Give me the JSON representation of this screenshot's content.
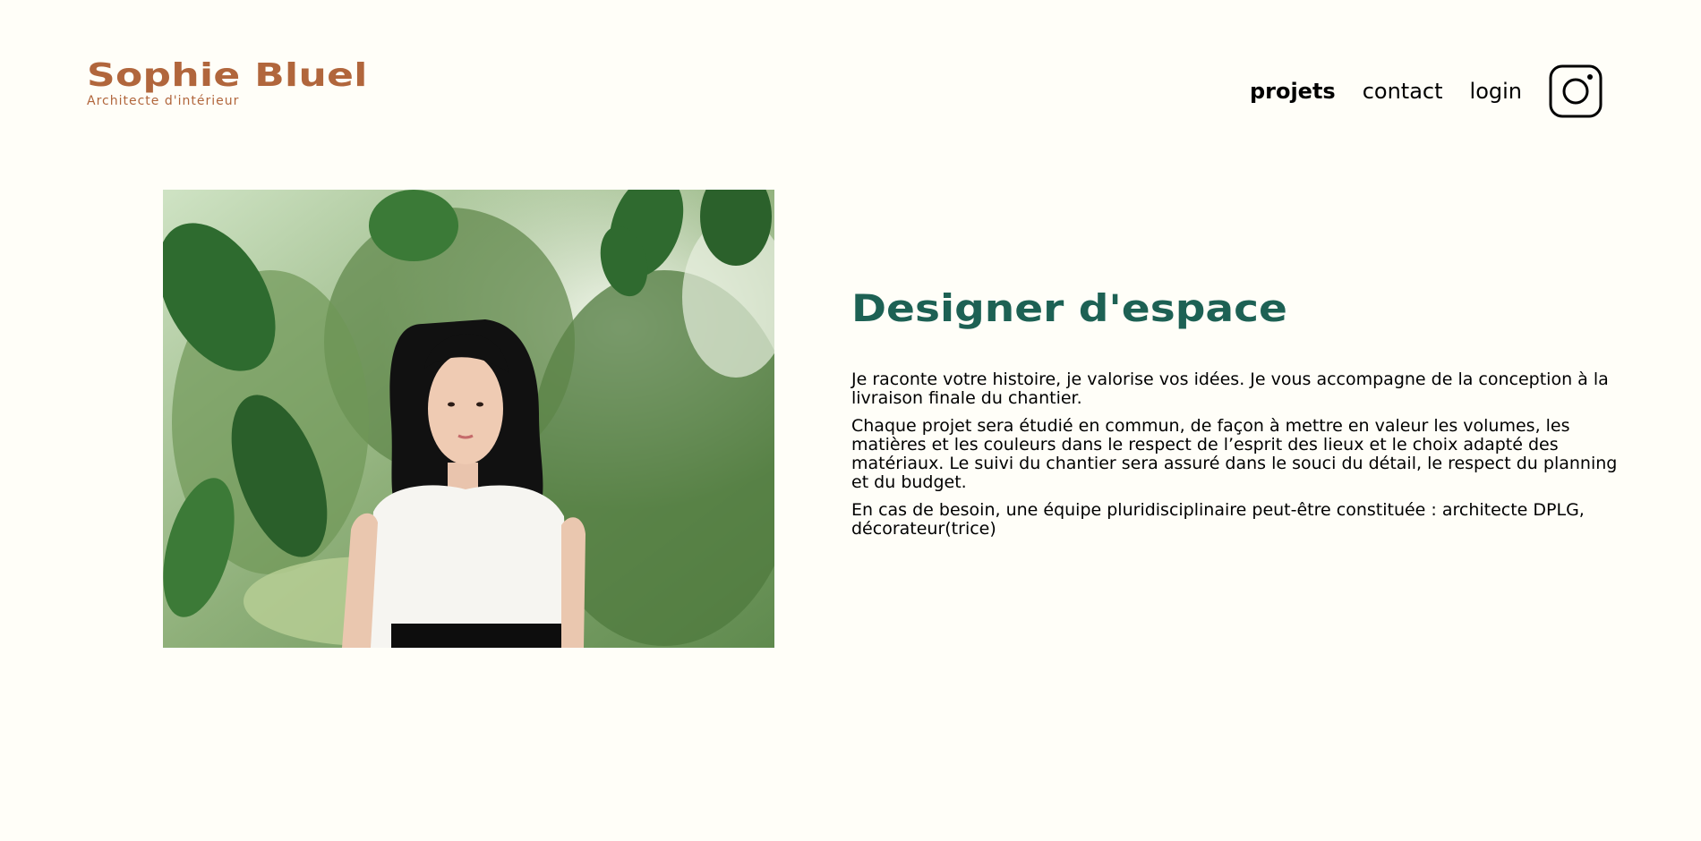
{
  "header": {
    "logo_title": "Sophie Bluel",
    "logo_subtitle": "Architecte d'intérieur",
    "nav": {
      "projects": "projets",
      "contact": "contact",
      "login": "login"
    },
    "instagram_icon": "instagram-icon"
  },
  "intro": {
    "photo_alt": "Sophie Bluel",
    "title": "Designer d'espace",
    "paragraphs": [
      "Je raconte votre histoire, je valorise vos idées. Je vous accompagne de la conception à la livraison finale du chantier.",
      "Chaque projet sera étudié en commun, de façon à mettre en valeur les volumes, les matières et les couleurs dans le respect de l’esprit des lieux et le choix adapté des matériaux. Le suivi du chantier sera assuré dans le souci du détail, le respect du planning et du budget.",
      "En cas de besoin, une équipe pluridisciplinaire peut-être constituée : architecte DPLG, décorateur(trice)"
    ]
  },
  "colors": {
    "background": "#FFFEF8",
    "brand": "#B1663C",
    "accent": "#1D6154"
  }
}
